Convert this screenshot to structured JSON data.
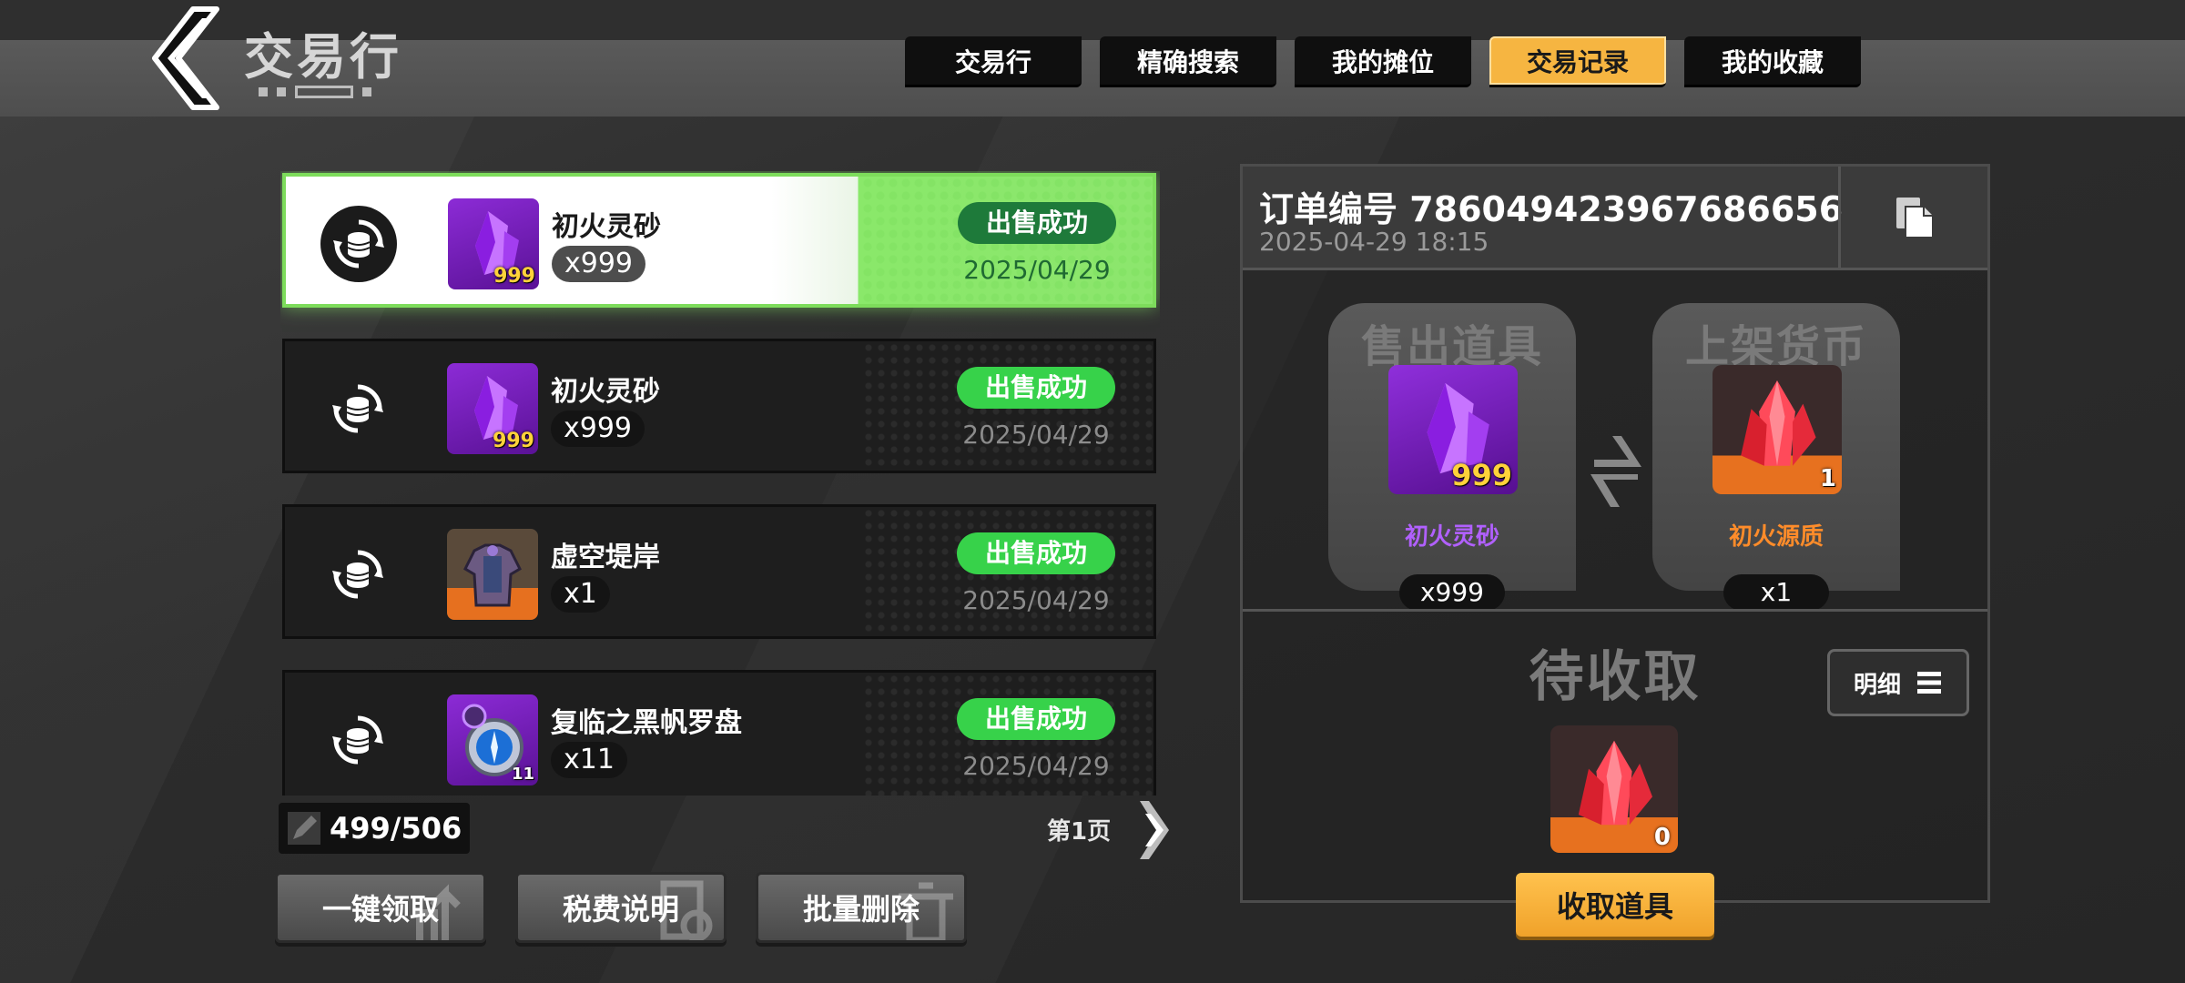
{
  "header": {
    "title": "交易行"
  },
  "tabs": [
    {
      "label": "交易行"
    },
    {
      "label": "精确搜索"
    },
    {
      "label": "我的摊位"
    },
    {
      "label": "交易记录",
      "active": true
    },
    {
      "label": "我的收藏"
    }
  ],
  "records": [
    {
      "name": "初火灵砂",
      "qty": "x999",
      "icon_count": "999",
      "status": "出售成功",
      "date": "2025/04/29",
      "icon": "purple-crystal-icon",
      "selected": true
    },
    {
      "name": "初火灵砂",
      "qty": "x999",
      "icon_count": "999",
      "status": "出售成功",
      "date": "2025/04/29",
      "icon": "purple-crystal-icon"
    },
    {
      "name": "虚空堤岸",
      "qty": "x1",
      "icon_count": "",
      "status": "出售成功",
      "date": "2025/04/29",
      "icon": "armor-icon"
    },
    {
      "name": "复临之黑帆罗盘",
      "qty": "x11",
      "icon_count": "11",
      "status": "出售成功",
      "date": "2025/04/29",
      "icon": "compass-icon"
    }
  ],
  "list_footer": {
    "count": "499/506",
    "page": "第1页"
  },
  "buttons": {
    "claim_all": "一键领取",
    "tax_info": "税费说明",
    "batch_delete": "批量删除"
  },
  "detail": {
    "order_no": "订单编号 786049423967686656",
    "time": "2025-04-29 18:15",
    "sold_label": "售出道具",
    "price_label": "上架货币",
    "sold_item": {
      "name": "初火灵砂",
      "count": "999",
      "qty": "x999"
    },
    "price_item": {
      "name": "初火源质",
      "count": "1",
      "qty": "x1"
    },
    "pending_title": "待收取",
    "detail_btn": "明细",
    "pending_count": "0",
    "collect_btn": "收取道具"
  },
  "colors": {
    "accent": "#f6b541",
    "success": "#37d24a",
    "selected_glow": "#7ddc5b",
    "purple_rarity": "#8c2bd6",
    "orange_rarity": "#e6701f"
  }
}
